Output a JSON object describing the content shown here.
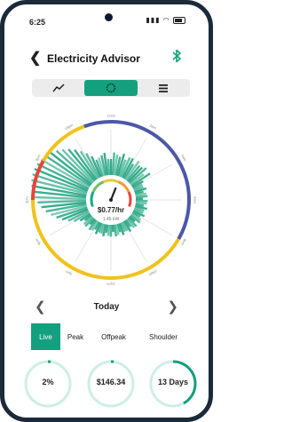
{
  "status_bar": {
    "time": "6:25"
  },
  "header": {
    "back_glyph": "❮",
    "title": "Electricity Advisor"
  },
  "view_toggle": {
    "selected": "dial"
  },
  "dial": {
    "hour_labels": [
      "12am",
      "2am",
      "4am",
      "6am",
      "8am",
      "10am",
      "12pm",
      "2pm",
      "4pm",
      "6pm",
      "8pm",
      "10pm"
    ],
    "rate_value": "$0.77/hr",
    "power_value": "1.46 kW",
    "gauge_level": 0.6,
    "ring_colors": {
      "peak": "#e8443a",
      "offpeak": "#4b58a8",
      "shoulder": "#f1c21b"
    },
    "usage_color": "#1ea37f"
  },
  "day_nav": {
    "label": "Today",
    "prev": "❮",
    "next": "❯"
  },
  "tabs": [
    {
      "label": "Live",
      "active": true
    },
    {
      "label": "Peak",
      "active": false
    },
    {
      "label": "Offpeak",
      "active": false
    },
    {
      "label": "Shoulder",
      "active": false
    }
  ],
  "kpis": [
    {
      "value": "2%",
      "progress": 0.02
    },
    {
      "value": "$146.34",
      "progress": 0.02
    },
    {
      "value": "13 Days",
      "progress": 0.42
    }
  ],
  "accent_color": "#14a07e"
}
